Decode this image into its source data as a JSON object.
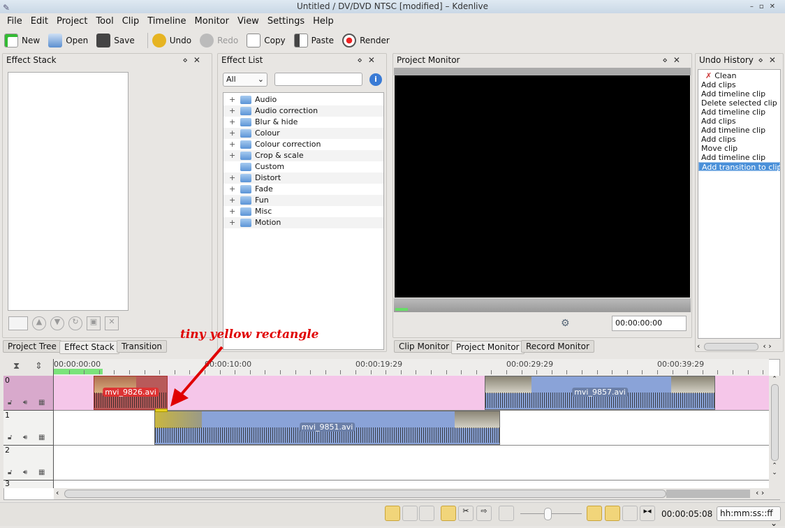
{
  "window": {
    "title": "Untitled / DV/DVD NTSC [modified] – Kdenlive"
  },
  "menu": [
    "File",
    "Edit",
    "Project",
    "Tool",
    "Clip",
    "Timeline",
    "Monitor",
    "View",
    "Settings",
    "Help"
  ],
  "toolbar": [
    {
      "label": "New",
      "icon": "new-file-icon"
    },
    {
      "label": "Open",
      "icon": "open-icon"
    },
    {
      "label": "Save",
      "icon": "save-icon"
    },
    {
      "label": "Undo",
      "icon": "undo-icon"
    },
    {
      "label": "Redo",
      "icon": "redo-icon"
    },
    {
      "label": "Copy",
      "icon": "copy-icon"
    },
    {
      "label": "Paste",
      "icon": "paste-icon"
    },
    {
      "label": "Render",
      "icon": "render-icon"
    }
  ],
  "effect_stack": {
    "title": "Effect Stack"
  },
  "effect_list": {
    "title": "Effect List",
    "filter": "All",
    "search_placeholder": "",
    "categories": [
      "Audio",
      "Audio correction",
      "Blur & hide",
      "Colour",
      "Colour correction",
      "Crop & scale",
      "Custom",
      "Distort",
      "Fade",
      "Fun",
      "Misc",
      "Motion"
    ]
  },
  "project_monitor": {
    "title": "Project Monitor",
    "timecode": "00:00:00:00"
  },
  "undo_history": {
    "title": "Undo History",
    "items": [
      "Clean",
      "Add clips",
      "Add timeline clip",
      "Delete selected clip",
      "Add timeline clip",
      "Add clips",
      "Add timeline clip",
      "Add clips",
      "Move clip",
      "Add timeline clip",
      "Add transition to clip"
    ],
    "selected": 10
  },
  "left_tabs": [
    "Project Tree",
    "Effect Stack",
    "Transition"
  ],
  "monitor_tabs": [
    "Clip Monitor",
    "Project Monitor",
    "Record Monitor"
  ],
  "annotation": "tiny yellow rectangle",
  "timeline": {
    "ruler": [
      "00:00:00:00",
      "00:00:10:00",
      "00:00:19:29",
      "00:00:29:29",
      "00:00:39:29"
    ],
    "tracks": [
      "0",
      "1",
      "2",
      "3"
    ],
    "clips": [
      {
        "name": "mvi_9826.avi",
        "track": 0
      },
      {
        "name": "mvi_9857.avi",
        "track": 0
      },
      {
        "name": "mvi_9851.avi",
        "track": 1
      }
    ]
  },
  "statusbar": {
    "timecode": "00:00:05:08",
    "format": "hh:mm:ss::ff"
  },
  "colors": {
    "track0": "#f5c6e9",
    "selection": "#4a90d9",
    "clip_blue": "#8aa3d8",
    "clip_red": "#c0392b",
    "annotation": "#e00000"
  }
}
